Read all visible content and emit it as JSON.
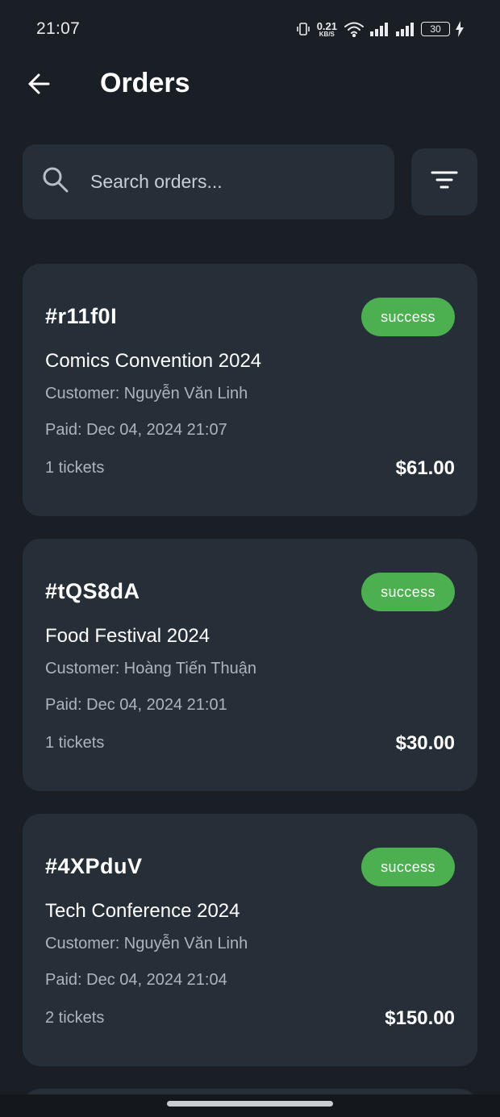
{
  "status_bar": {
    "time": "21:07",
    "net_speed_value": "0.21",
    "net_speed_unit": "KB/S",
    "network_type": "4",
    "battery": "30",
    "icons": [
      "vibrate-icon",
      "wifi-icon",
      "signal-icon",
      "signal-icon",
      "battery-icon",
      "charging-icon"
    ]
  },
  "app_bar": {
    "title": "Orders",
    "back_icon": "arrow-left-icon"
  },
  "search": {
    "placeholder": "Search orders...",
    "value": "",
    "icon": "search-icon"
  },
  "filter": {
    "icon": "filter-icon"
  },
  "orders": [
    {
      "id": "#r11f0I",
      "status": "success",
      "event": "Comics Convention 2024",
      "customer": "Customer: Nguyễn Văn Linh",
      "paid": "Paid: Dec 04, 2024 21:07",
      "tickets": "1 tickets",
      "amount": "$61.00"
    },
    {
      "id": "#tQS8dA",
      "status": "success",
      "event": "Food Festival 2024",
      "customer": "Customer: Hoàng Tiến Thuận",
      "paid": "Paid: Dec 04, 2024 21:01",
      "tickets": "1 tickets",
      "amount": "$30.00"
    },
    {
      "id": "#4XPduV",
      "status": "success",
      "event": "Tech Conference 2024",
      "customer": "Customer: Nguyễn Văn Linh",
      "paid": "Paid: Dec 04, 2024 21:04",
      "tickets": "2 tickets",
      "amount": "$150.00"
    }
  ],
  "colors": {
    "background": "#1a1f26",
    "card": "#262e38",
    "success_badge": "#4caf50",
    "secondary_text": "#aeb4bd"
  }
}
